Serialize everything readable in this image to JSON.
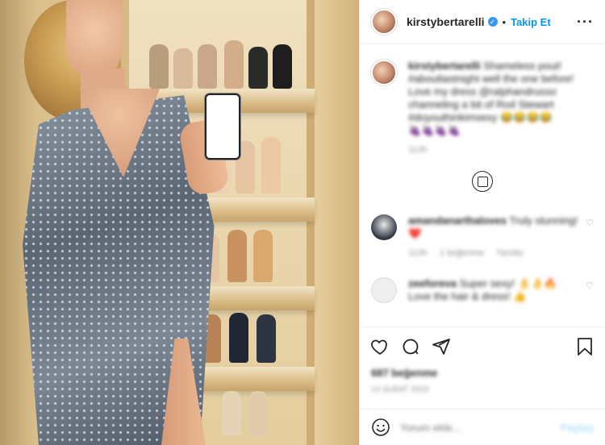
{
  "post": {
    "username": "kirstybertarelli",
    "verified": true,
    "follow_label": "Takip Et",
    "separator": "•",
    "more_icon": "more-horizontal-icon"
  },
  "comments": [
    {
      "username": "kirstybertarelli",
      "text": "Shameless pout! #aboutlastnight well the one before! Love my dress @ralphandrusso channeling a bit of Rod Stewart #doyouthinkimsexy 😂😂😂😂",
      "emoji_extra": "🍇🍇🍇🍇",
      "meta": [
        "113h"
      ]
    },
    {
      "username": "amandanarthaloves",
      "text": "Truly stunning! ❤️",
      "meta": [
        "113h",
        "1 beğenme",
        "Yanıtla"
      ]
    },
    {
      "username": "zeeforeva",
      "text": "Super sexy! 👌👌🔥 Love the hair & dress! 👍",
      "meta": []
    }
  ],
  "actions": {
    "like_icon": "heart-icon",
    "comment_icon": "comment-icon",
    "share_icon": "send-icon",
    "save_icon": "bookmark-icon"
  },
  "likes_text": "687 beğenme",
  "time_text": "14 şubat 2019",
  "composer": {
    "placeholder": "Yorum ekle...",
    "post_label": "Paylaş",
    "emoji_icon": "emoji-icon"
  },
  "colors": {
    "accent": "#0095f6",
    "verified": "#3897f0",
    "text": "#262626",
    "muted": "#8e8e8e"
  }
}
